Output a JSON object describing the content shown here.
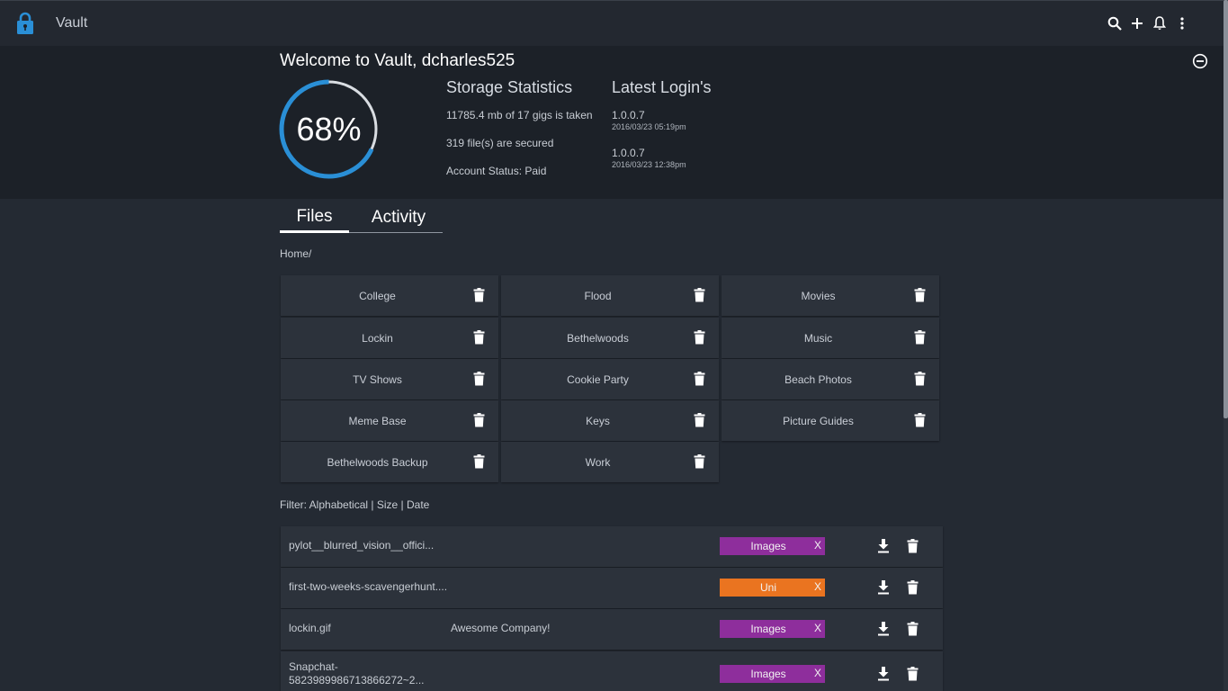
{
  "app": {
    "title": "Vault"
  },
  "header": {
    "welcome": "Welcome to Vault, dcharles525",
    "percent_text": "68%",
    "percent_value": 0.68,
    "storage": {
      "heading": "Storage Statistics",
      "used": "11785.4 mb of 17 gigs is taken",
      "secured": "319 file(s) are secured",
      "status": "Account Status: Paid"
    },
    "logins": {
      "heading": "Latest Login's",
      "entries": [
        {
          "ip": "1.0.0.7",
          "time": "2016/03/23 05:19pm"
        },
        {
          "ip": "1.0.0.7",
          "time": "2016/03/23 12:38pm"
        }
      ]
    }
  },
  "tabs": {
    "files": "Files",
    "activity": "Activity"
  },
  "breadcrumb": "Home/",
  "folders": [
    "College",
    "Flood",
    "Movies",
    "Lockin",
    "Bethelwoods",
    "Music",
    "TV Shows",
    "Cookie Party",
    "Beach Photos",
    "Meme Base",
    "Keys",
    "Picture Guides",
    "Bethelwoods Backup",
    "Work"
  ],
  "filter": {
    "label": "Filter: ",
    "alphabetical": "Alphabetical",
    "sep1": " | ",
    "size": "Size",
    "sep2": " | ",
    "date": "Date"
  },
  "files": [
    {
      "name": "pylot__blurred_vision__offici...",
      "company": "",
      "tag": "Images",
      "tag_color": "#8e2e9c",
      "remove": "X"
    },
    {
      "name": "first-two-weeks-scavengerhunt....",
      "company": "",
      "tag": "Uni",
      "tag_color": "#ea7420",
      "remove": "X"
    },
    {
      "name": "lockin.gif",
      "company": "Awesome Company!",
      "tag": "Images",
      "tag_color": "#8e2e9c",
      "remove": "X"
    },
    {
      "name": "Snapchat-\n5823989986713866272~2...",
      "company": "",
      "tag": "Images",
      "tag_color": "#8e2e9c",
      "remove": "X"
    }
  ],
  "colors": {
    "accent": "#2a8fd6",
    "background": "#242a33",
    "panel": "#1c2128",
    "card": "#2c323b"
  }
}
